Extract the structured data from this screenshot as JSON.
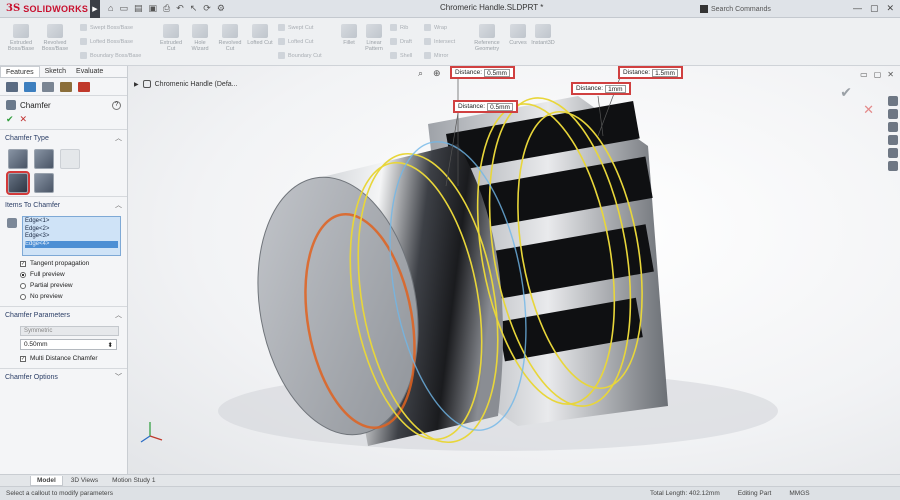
{
  "app": {
    "brand_prefix": "3S",
    "brand_name": "SOLIDWORKS",
    "document_title": "Chromeric Handle.SLDPRT *",
    "search_placeholder": "Search Commands"
  },
  "command_manager": {
    "large_buttons": [
      "Extruded Boss/Base",
      "Revolved Boss/Base",
      "Extruded Cut",
      "Hole Wizard",
      "Revolved Cut",
      "Lofted Cut"
    ],
    "small_buttons": [
      "Swept Boss/Base",
      "Lofted Boss/Base",
      "Boundary Boss/Base",
      "Swept Cut",
      "Lofted Cut",
      "Boundary Cut",
      "Fillet",
      "Linear Pattern",
      "Rib",
      "Draft",
      "Shell",
      "Wrap",
      "Intersect",
      "Mirror",
      "Reference Geometry",
      "Curves",
      "Instant3D"
    ]
  },
  "panel": {
    "tabs": [
      "Features",
      "Sketch",
      "Evaluate"
    ],
    "feature_title": "Chamfer",
    "groups": {
      "type": "Chamfer Type",
      "items": "Items To Chamfer",
      "parameters": "Chamfer Parameters",
      "options": "Chamfer Options"
    },
    "edges": [
      "Edge<1>",
      "Edge<2>",
      "Edge<3>",
      "Edge<4>"
    ],
    "tangent_propagation": "Tangent propagation",
    "preview_options": [
      "Full preview",
      "Partial preview",
      "No preview"
    ],
    "symmetric_label": "Symmetric",
    "distance_value": "0.50mm",
    "multi_distance_label": "Multi Distance Chamfer"
  },
  "viewport": {
    "tree_path": "Chromenic Handle  (Defa...",
    "callouts": [
      {
        "label": "Distance:",
        "value": "0.5mm"
      },
      {
        "label": "Distance:",
        "value": "0.5mm"
      },
      {
        "label": "Distance:",
        "value": "1mm"
      },
      {
        "label": "Distance:",
        "value": "1.5mm"
      }
    ]
  },
  "bottom_tabs": [
    "Model",
    "3D Views",
    "Motion Study 1"
  ],
  "status": {
    "message": "Select a callout to modify parameters",
    "total_length": "Total Length: 402.12mm",
    "mode": "Editing Part",
    "units": "MMGS"
  },
  "colors": {
    "brand": "#c8102e",
    "highlight_red": "#d04040",
    "preview_yellow": "#e8d63a",
    "edge_orange": "#e0621f",
    "selection_blue": "#4d8fd4"
  }
}
